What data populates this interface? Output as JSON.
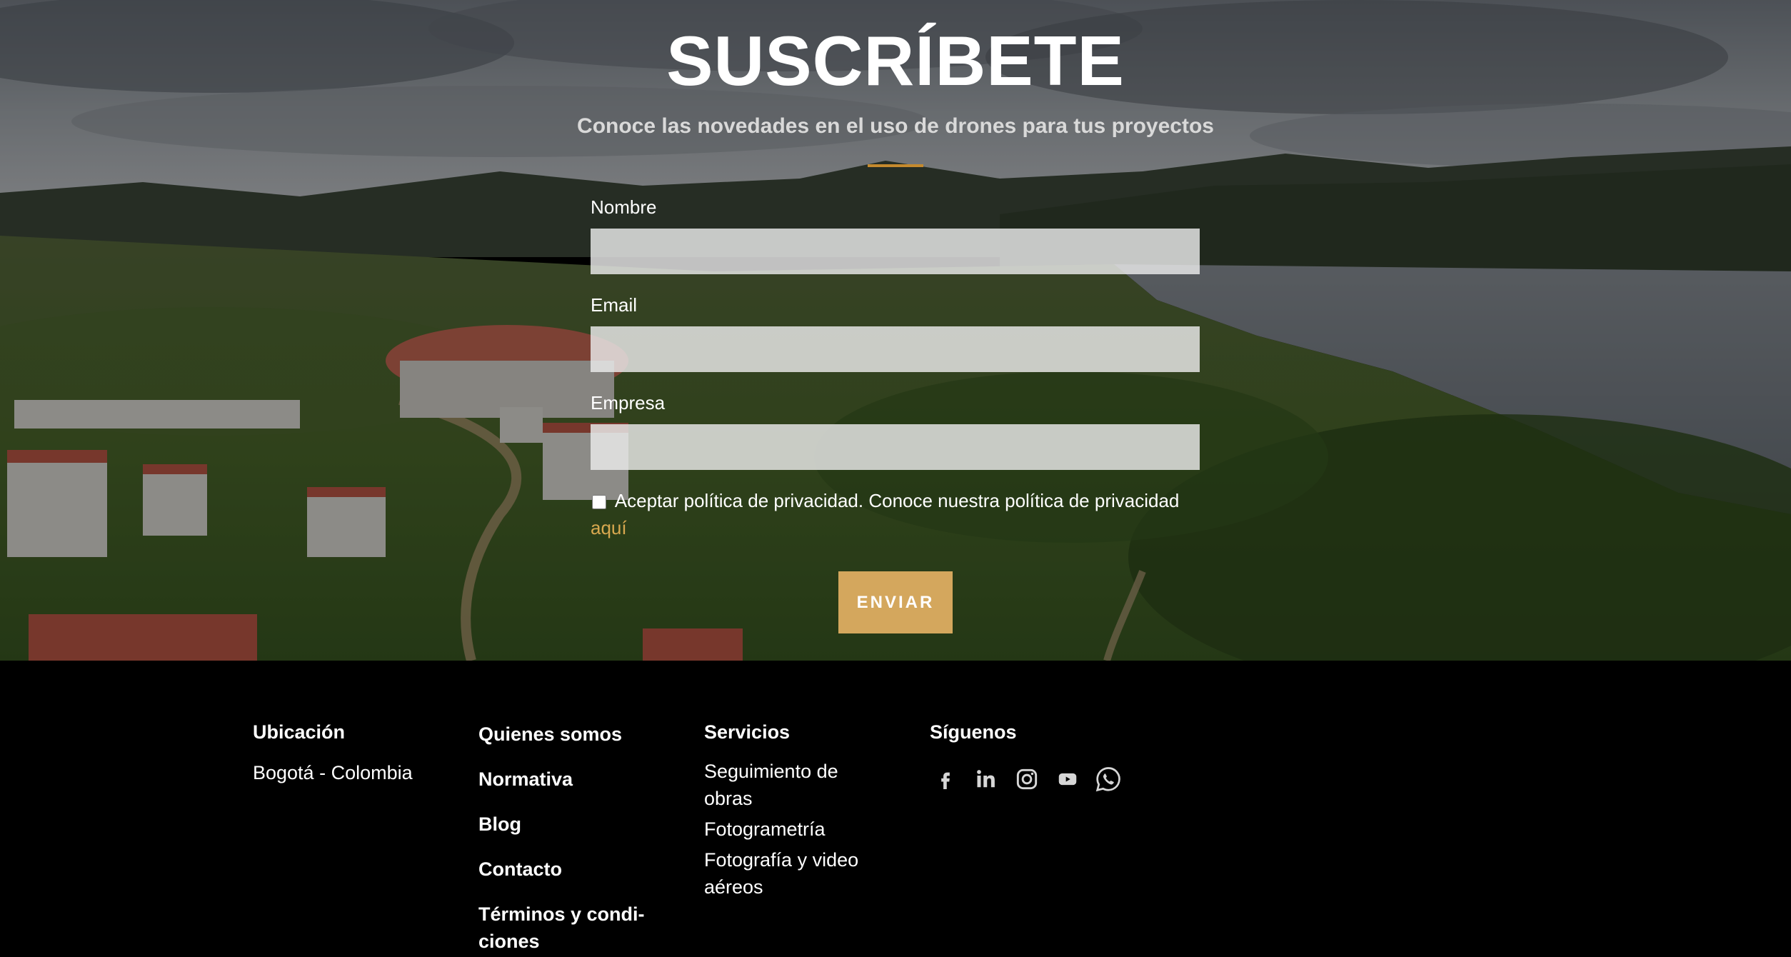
{
  "subscribe": {
    "title": "SUSCRÍBETE",
    "subtitle": "Conoce las novedades en el uso de drones para tus proyectos",
    "fields": [
      {
        "label": "Nombre",
        "value": "",
        "placeholder": ""
      },
      {
        "label": "Email",
        "value": "",
        "placeholder": ""
      },
      {
        "label": "Empresa",
        "value": "",
        "placeholder": ""
      }
    ],
    "consent_text": "Aceptar política de privacidad. Conoce nuestra política de privacidad",
    "consent_link": "aquí",
    "consent_checked": false,
    "submit_label": "ENVIAR"
  },
  "footer": {
    "location": {
      "heading": "Ubicación",
      "text": "Bogotá - Colombia"
    },
    "links": [
      {
        "label": "Quienes somos"
      },
      {
        "label": "Normativa"
      },
      {
        "label": "Blog"
      },
      {
        "label": "Contacto"
      },
      {
        "label": "Términos y condi-"
      },
      {
        "label": "ciones"
      }
    ],
    "services": {
      "heading": "Servicios",
      "items": [
        {
          "line1": "Seguimiento de",
          "line2": "obras"
        },
        {
          "line1": "Fotogrametría",
          "line2": ""
        },
        {
          "line1": "Fotografía y video",
          "line2": "aéreos"
        }
      ]
    },
    "social": {
      "heading": "Síguenos",
      "icons": [
        "facebook-icon",
        "linkedin-icon",
        "instagram-icon",
        "youtube-icon",
        "whatsapp-icon"
      ]
    }
  },
  "colors": {
    "accent": "#d4a75d",
    "link": "#d8a84f",
    "divider": "#c58a2e",
    "footer_bg": "#000000"
  }
}
